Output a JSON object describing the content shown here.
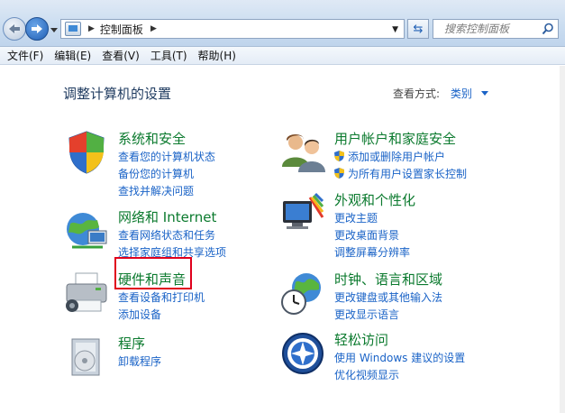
{
  "address": {
    "breadcrumb": "控制面板",
    "search_placeholder": "搜索控制面板"
  },
  "menu": [
    "文件(F)",
    "编辑(E)",
    "查看(V)",
    "工具(T)",
    "帮助(H)"
  ],
  "header": {
    "title": "调整计算机的设置",
    "view_by_label": "查看方式:",
    "view_by_value": "类别"
  },
  "categories": [
    {
      "title": "系统和安全",
      "links": [
        "查看您的计算机状态",
        "备份您的计算机",
        "查找并解决问题"
      ],
      "icon": "shield-flag-icon"
    },
    {
      "title": "用户帐户和家庭安全",
      "links": [
        "添加或删除用户帐户",
        "为所有用户设置家长控制"
      ],
      "icon": "users-icon"
    },
    {
      "title": "网络和 Internet",
      "links": [
        "查看网络状态和任务",
        "选择家庭组和共享选项"
      ],
      "icon": "network-icon"
    },
    {
      "title": "外观和个性化",
      "links": [
        "更改主题",
        "更改桌面背景",
        "调整屏幕分辨率"
      ],
      "icon": "monitor-palette-icon"
    },
    {
      "title": "硬件和声音",
      "links": [
        "查看设备和打印机",
        "添加设备"
      ],
      "icon": "printer-icon"
    },
    {
      "title": "时钟、语言和区域",
      "links": [
        "更改键盘或其他输入法",
        "更改显示语言"
      ],
      "icon": "clock-globe-icon"
    },
    {
      "title": "程序",
      "links": [
        "卸载程序"
      ],
      "icon": "programs-icon"
    },
    {
      "title": "轻松访问",
      "links": [
        "使用 Windows 建议的设置",
        "优化视频显示"
      ],
      "icon": "ease-of-access-icon"
    }
  ]
}
